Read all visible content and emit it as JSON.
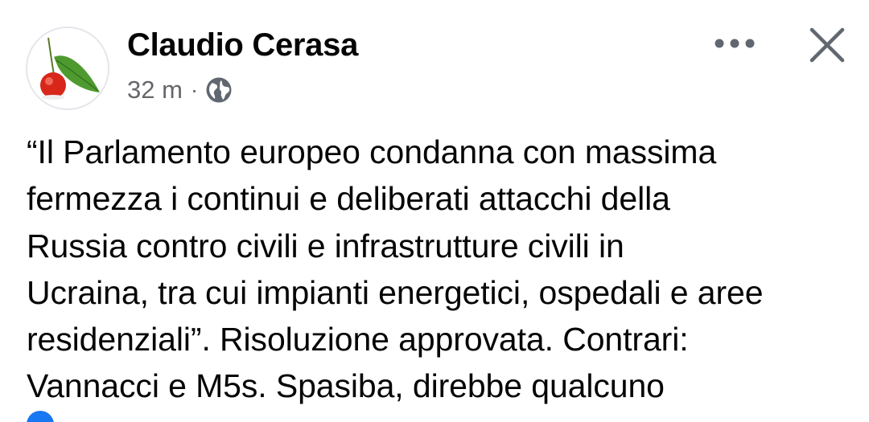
{
  "post": {
    "author": "Claudio Cerasa",
    "timestamp": "32 m",
    "separator": "·",
    "visibility_icon": "globe-icon",
    "body_lines": [
      "“Il Parlamento europeo condanna con massima",
      "fermezza i continui e deliberati attacchi della",
      "Russia contro civili e infrastrutture civili in",
      "Ucraina, tra cui impianti energetici, ospedali e aree",
      "residenziali”. Risoluzione approvata. Contrari:",
      "Vannacci e M5s. Spasiba, direbbe qualcuno"
    ]
  },
  "actions": {
    "more_icon": "more-options-icon",
    "close_icon": "close-icon"
  },
  "colors": {
    "text_primary": "#050505",
    "text_secondary": "#65676b",
    "icon_gray": "#606770",
    "like_blue": "#1877f2"
  }
}
